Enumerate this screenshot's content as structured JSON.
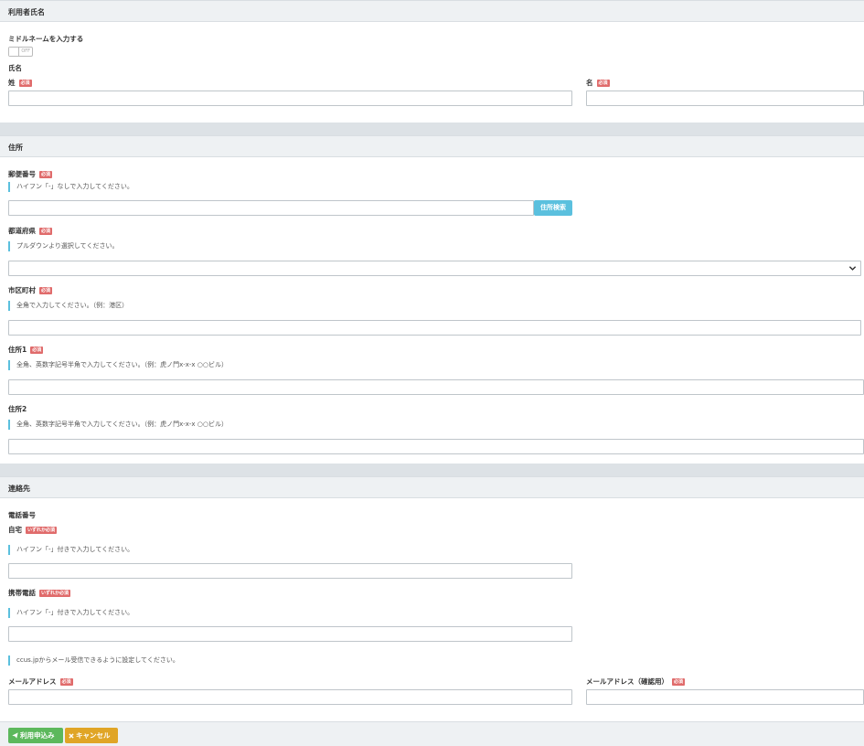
{
  "required_badge": "必須",
  "either_required_badge": "いずれか必須",
  "name_section": {
    "title": "利用者氏名",
    "middle_name_toggle_label": "ミドルネームを入力する",
    "toggle_state": "OFF",
    "name_label": "氏名",
    "last_name_label": "姓",
    "first_name_label": "名"
  },
  "address_section": {
    "title": "住所",
    "postal_label": "郵便番号",
    "postal_hint": "ハイフン「-」なしで入力してください。",
    "search_button": "住所検索",
    "prefecture_label": "都道府県",
    "prefecture_hint": "プルダウンより選択してください。",
    "city_label": "市区町村",
    "city_hint": "全角で入力してください。（例：港区）",
    "address1_label": "住所1",
    "address1_hint": "全角、英数字記号半角で入力してください。（例：虎ノ門x-x-x ○○ビル）",
    "address2_label": "住所2",
    "address2_hint": "全角、英数字記号半角で入力してください。（例：虎ノ門x-x-x ○○ビル）"
  },
  "contact_section": {
    "title": "連絡先",
    "phone_label": "電話番号",
    "home_label": "自宅",
    "home_hint": "ハイフン「-」付きで入力してください。",
    "mobile_label": "携帯電話",
    "mobile_hint": "ハイフン「-」付きで入力してください。",
    "mail_hint": "ccus.jpからメール受信できるように設定してください。",
    "email_label": "メールアドレス",
    "email_confirm_label": "メールアドレス（確認用）"
  },
  "footer": {
    "apply_button": "利用申込み",
    "cancel_button": "キャンセル"
  },
  "colors": {
    "required": "#e06b6b",
    "info_accent": "#5bc0de",
    "apply": "#5cb85c",
    "cancel": "#e0a526"
  }
}
